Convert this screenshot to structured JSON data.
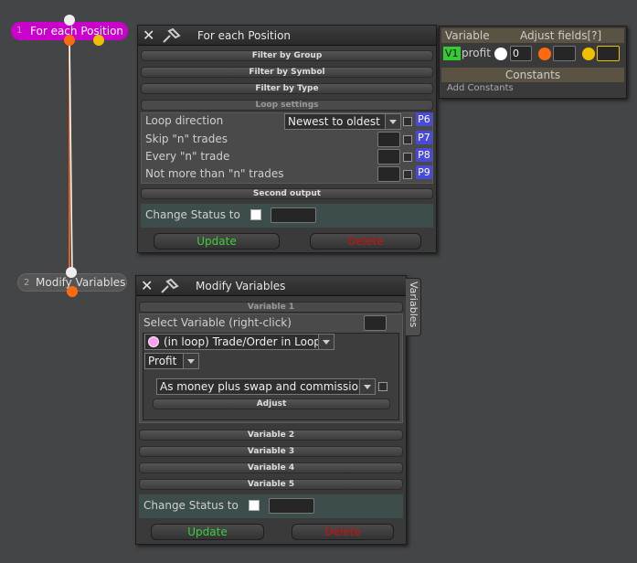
{
  "nodes": [
    {
      "num": "1",
      "label": "For each Position"
    },
    {
      "num": "2",
      "label": "Modify Variables"
    }
  ],
  "p1": {
    "title": "For each Position",
    "sections": [
      "Filter by Group",
      "Filter by Symbol",
      "Filter by Type",
      "Loop settings"
    ],
    "rows": [
      {
        "label": "Loop direction",
        "badge": "P6"
      },
      {
        "label": "Skip \"n\" trades",
        "badge": "P7"
      },
      {
        "label": "Every \"n\" trade",
        "badge": "P8"
      },
      {
        "label": "Not more than \"n\" trades",
        "badge": "P9"
      }
    ],
    "loop_direction": "Newest to oldest",
    "second_output": "Second output",
    "change_status": "Change Status to",
    "update": "Update",
    "delete": "Delete"
  },
  "vars": {
    "header_variable": "Variable",
    "header_adjust": "Adjust fields[?]",
    "badge": "V1",
    "name": "profit",
    "value": "0",
    "constants": "Constants",
    "add_constants": "Add Constants"
  },
  "p2": {
    "title": "Modify Variables",
    "side_tab": "Variables",
    "variable1": "Variable 1",
    "select_variable": "Select Variable (right-click)",
    "loop_item": "(in loop) Trade/Order in Loop",
    "profit": "Profit",
    "money": "As money plus swap and commission",
    "adjust": "Adjust",
    "others": [
      "Variable 2",
      "Variable 3",
      "Variable 4",
      "Variable 5"
    ],
    "change_status": "Change Status to",
    "update": "Update",
    "delete": "Delete"
  },
  "colors": {
    "node1": "#cc00cc",
    "node2": "#4a4a4a",
    "wire": "#e06020",
    "link": "#ffffff",
    "update": "#3ccf3c",
    "delete": "#cc1010",
    "badge": "#4a4ad8",
    "v1": "#33cc33"
  }
}
